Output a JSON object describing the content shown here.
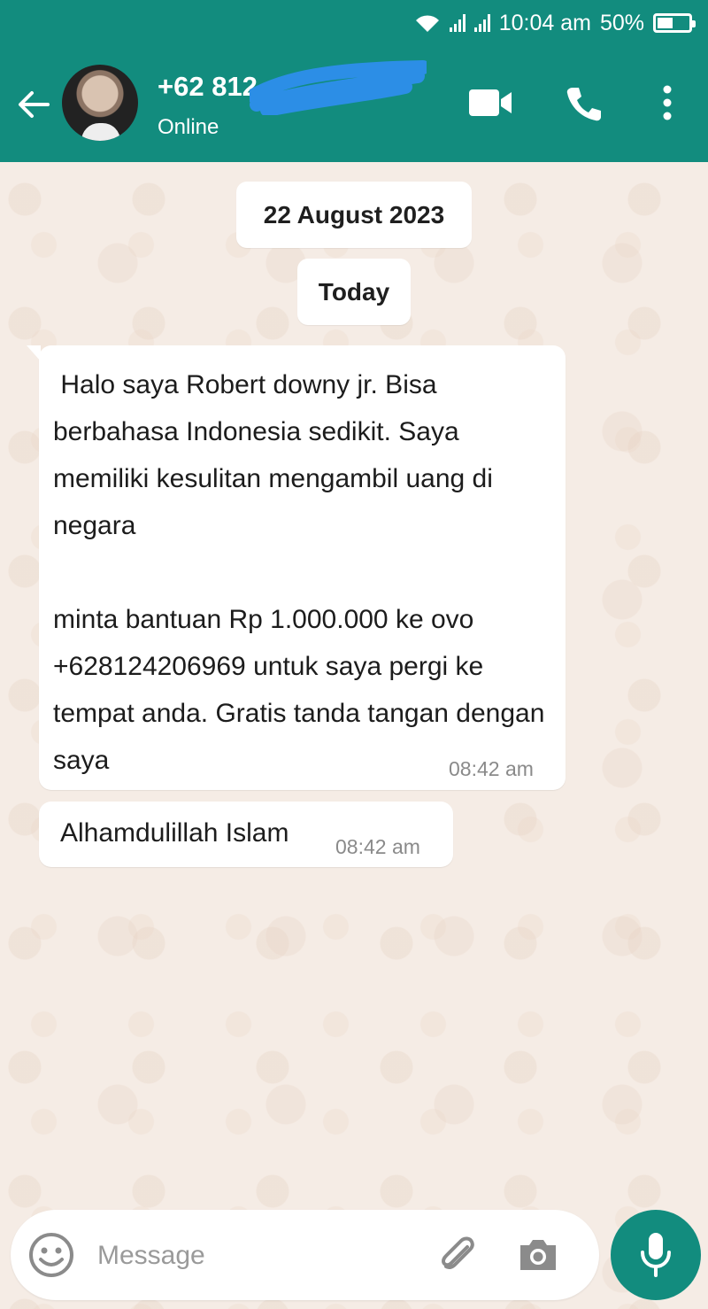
{
  "status_bar": {
    "time": "10:04 am",
    "battery_percent": "50%",
    "battery_level": 0.5,
    "icons": [
      "wifi-icon",
      "signal-icon",
      "signal-icon",
      "battery-icon"
    ]
  },
  "header": {
    "contact_name": "+62 812",
    "contact_status": "Online",
    "icons": [
      "back-arrow-icon",
      "video-call-icon",
      "voice-call-icon",
      "more-options-icon"
    ]
  },
  "chat": {
    "date_chips": [
      "22 August 2023",
      "Today"
    ],
    "messages": [
      {
        "text": " Halo saya Robert downy jr. Bisa berbahasa Indonesia sedikit. Saya memiliki kesulitan mengambil uang di negara\n\nminta bantuan Rp 1.000.000 ke ovo +628124206969 untuk saya pergi ke tempat anda. Gratis tanda tangan dengan saya",
        "time": "08:42 am"
      },
      {
        "text": "Alhamdulillah Islam",
        "time": "08:42 am"
      }
    ]
  },
  "composer": {
    "placeholder": "Message",
    "icons": [
      "emoji-icon",
      "attach-icon",
      "camera-icon",
      "mic-icon"
    ]
  },
  "colors": {
    "header": "#128c7e",
    "wallpaper": "#f5ece5",
    "bubble": "#ffffff",
    "timestamp": "#8a8a8a"
  }
}
